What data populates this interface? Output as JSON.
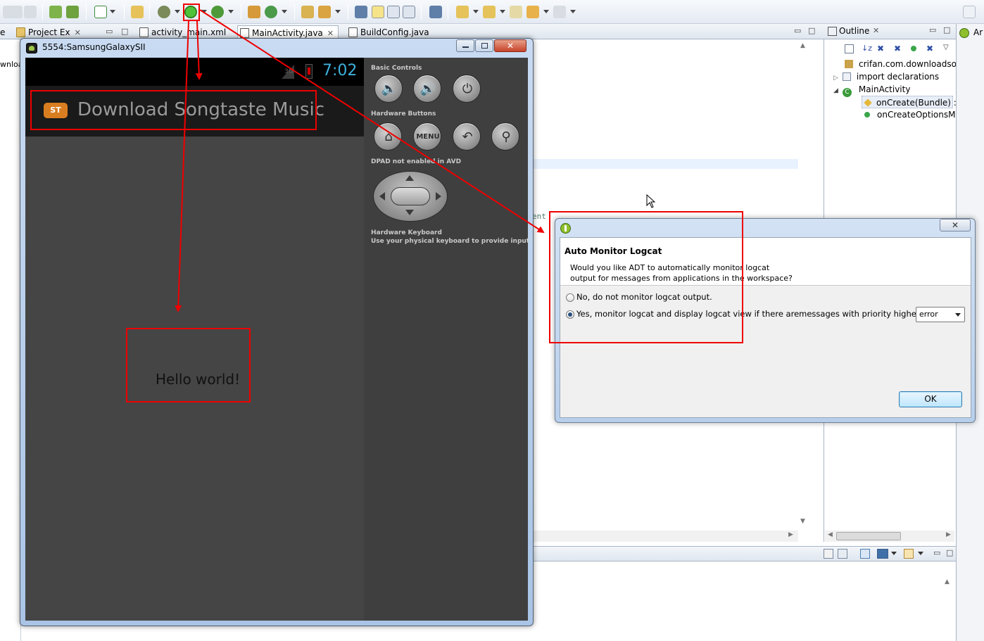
{
  "editor_tabs": [
    {
      "label": "e"
    },
    {
      "label": "Project Ex"
    },
    {
      "label": "activity_main.xml"
    },
    {
      "label": "MainActivity.java"
    },
    {
      "label": "BuildConfig.java"
    }
  ],
  "left_strip_text": "wnloa",
  "editor_snippet": "ent",
  "outline": {
    "title": "Outline",
    "items": [
      {
        "label": "crifan.com.downloadsor"
      },
      {
        "label": "import declarations"
      },
      {
        "label": "MainActivity"
      },
      {
        "label": "onCreate(Bundle) :"
      },
      {
        "label": "onCreateOptionsM"
      }
    ]
  },
  "right_strip_text": "Ar",
  "emulator": {
    "title": "5554:SamsungGalaxySII",
    "clock": "7:02",
    "app_icon_text": "ST",
    "app_title": "Download Songtaste Music",
    "hello_text": "Hello world!",
    "controls": {
      "basic_controls_label": "Basic Controls",
      "hardware_buttons_label": "Hardware Buttons",
      "menu_label": "MENU",
      "dpad_label": "DPAD not enabled in AVD",
      "keyboard_label": "Hardware Keyboard",
      "keyboard_hint": "Use your physical keyboard to provide input"
    }
  },
  "dialog": {
    "title": "Auto Monitor Logcat",
    "message_line1": "Would you like ADT to automatically monitor logcat",
    "message_line2": "output for messages from applications in the workspace?",
    "option_no": "No, do not monitor logcat output.",
    "option_yes": "Yes, monitor logcat and display logcat view if there aremessages with priority higher than:",
    "selected_option": "yes",
    "priority_value": "error",
    "ok_label": "OK"
  },
  "colors": {
    "annotation_red": "#ee0000",
    "clock_blue": "#3fb1de",
    "android_green": "#9ec64a"
  }
}
